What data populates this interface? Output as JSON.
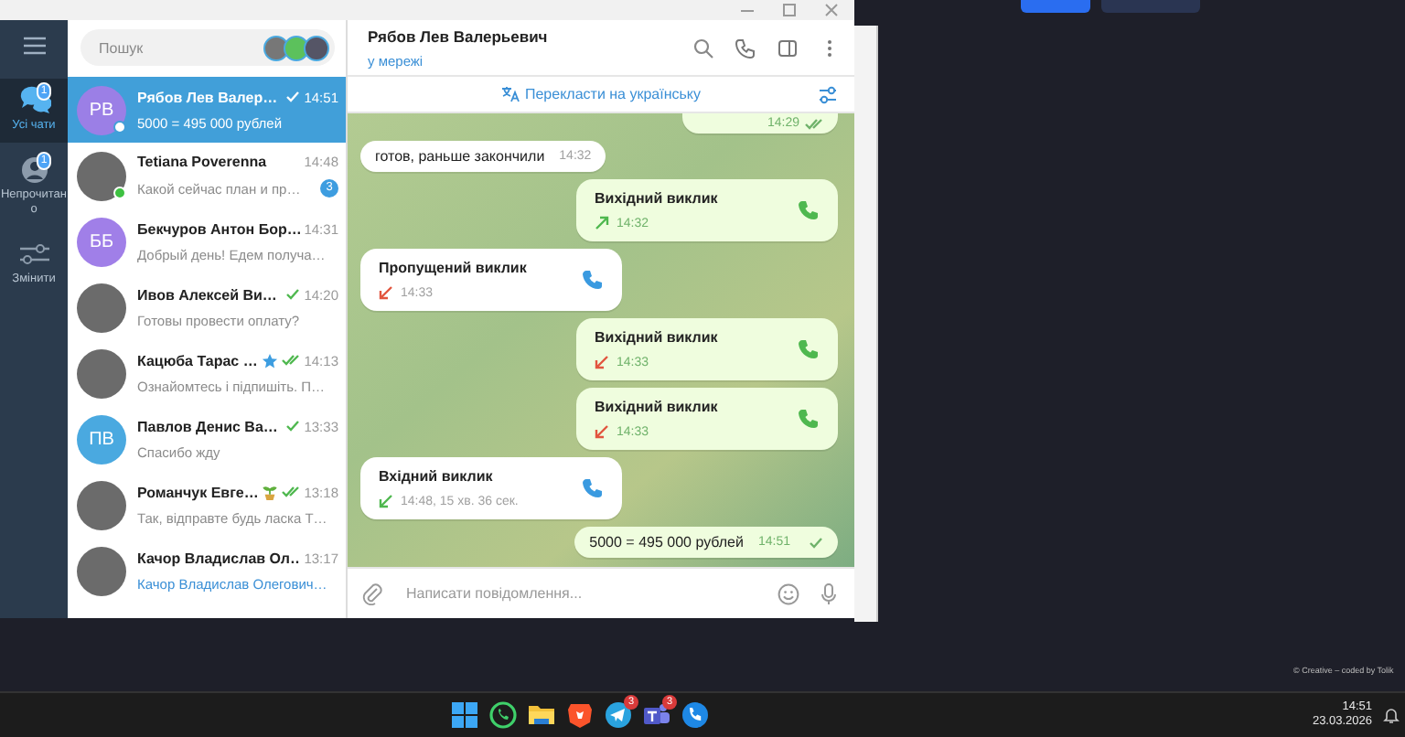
{
  "nav": {
    "items": [
      {
        "kind": "chats",
        "label": "Усі чати",
        "selected": true,
        "badge": "1"
      },
      {
        "kind": "unread",
        "label": "Непрочитано",
        "selected": false,
        "badge": "1"
      },
      {
        "kind": "edit",
        "label": "Змінити",
        "selected": false
      }
    ]
  },
  "search": {
    "placeholder": "Пошук"
  },
  "chats": [
    {
      "name": "Рябов Лев Валер…",
      "time": "14:51",
      "preview": "5000 = 495 000 рублей",
      "avatar": {
        "kind": "initials",
        "initials": "РВ",
        "color": "#9b7fe6"
      },
      "selected": true,
      "online": true,
      "sent": true,
      "read": false
    },
    {
      "name": "Tetiana Poverenna",
      "time": "14:48",
      "preview": "Какой сейчас план и пр…",
      "avatar": {
        "kind": "photo"
      },
      "selected": false,
      "online": true,
      "unread": "3"
    },
    {
      "name": "Бекчуров Антон Бор…",
      "time": "14:31",
      "preview": "Добрый день! Едем получа…",
      "avatar": {
        "kind": "initials",
        "initials": "ББ",
        "color": "#a07fe8"
      },
      "selected": false,
      "online": false
    },
    {
      "name": "Ивов Алексей Ви…",
      "time": "14:20",
      "preview": "Готовы провести оплату?",
      "avatar": {
        "kind": "photo"
      },
      "selected": false,
      "online": false,
      "sent": true,
      "read": false
    },
    {
      "name": "Кацюба Тарас …",
      "time": "14:13",
      "preview": "Ознайомтесь і підпишіть. П…",
      "avatar": {
        "kind": "photo"
      },
      "selected": false,
      "online": false,
      "sent": true,
      "read": true,
      "starred": true
    },
    {
      "name": "Павлов Денис Ва…",
      "time": "13:33",
      "preview": "Спасибо жду",
      "avatar": {
        "kind": "initials",
        "initials": "ПВ",
        "color": "#4aa9e0"
      },
      "selected": false,
      "online": false,
      "sent": true,
      "read": false
    },
    {
      "name": "Романчук Евге…",
      "time": "13:18",
      "preview": "Так, відправте будь ласка Т…",
      "avatar": {
        "kind": "photo"
      },
      "selected": false,
      "online": false,
      "sent": true,
      "read": true,
      "sprout": true
    },
    {
      "name": "Качор Владислав Ол…",
      "time": "13:17",
      "preview": "Качор Владислав Олегович…",
      "avatar": {
        "kind": "photo"
      },
      "selected": false,
      "online": false,
      "preview_highlighted": true
    }
  ],
  "chat": {
    "name": "Рябов Лев Валерьевич",
    "status": "у мережі",
    "translate": "Перекласти на українську",
    "messages": [
      {
        "kind": "stub",
        "outgoing": true,
        "time": "14:29",
        "read": true
      },
      {
        "kind": "text",
        "outgoing": false,
        "text": "готов, раньше закончили",
        "time": "14:32"
      },
      {
        "kind": "call",
        "outgoing": true,
        "text": "Вихідний виклик",
        "time": "14:32",
        "missed": false
      },
      {
        "kind": "call",
        "outgoing": false,
        "text": "Пропущений виклик",
        "time": "14:33",
        "missed": true
      },
      {
        "kind": "call",
        "outgoing": true,
        "text": "Вихідний виклик",
        "time": "14:33",
        "missed": true
      },
      {
        "kind": "call",
        "outgoing": true,
        "text": "Вихідний виклик",
        "time": "14:33",
        "missed": true
      },
      {
        "kind": "call",
        "outgoing": false,
        "text": "Вхідний виклик",
        "time": "14:48, 15 хв. 36 сек.",
        "missed": false
      },
      {
        "kind": "text",
        "outgoing": true,
        "text": "5000 = 495 000 рублей",
        "time": "14:51",
        "read": false
      }
    ],
    "composer": {
      "placeholder": "Написати повідомлення..."
    }
  },
  "desktop": {
    "credit": "© Creative – coded by Tolik",
    "taskbar": [
      {
        "kind": "windows"
      },
      {
        "kind": "whatsapp"
      },
      {
        "kind": "folder"
      },
      {
        "kind": "brave"
      },
      {
        "kind": "telegram",
        "badge": "3"
      },
      {
        "kind": "teams",
        "badge": "3"
      },
      {
        "kind": "phone"
      }
    ],
    "clock": {
      "time": "14:51",
      "date": "23.03.2026"
    }
  }
}
